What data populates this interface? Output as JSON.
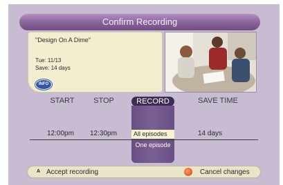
{
  "dialog": {
    "title": "Confirm Recording"
  },
  "program": {
    "title": "\"Design On A Dime\"",
    "date": "Tue:  11/13",
    "save": "Save:  14 days",
    "info_label": "INFO"
  },
  "columns": {
    "start": "START",
    "stop": "STOP",
    "record": "RECORD",
    "save_time": "SAVE TIME"
  },
  "values": {
    "start": "12:00pm",
    "stop": "12:30pm",
    "save_time": "14 days"
  },
  "record_options": {
    "selected": "All episodes",
    "other": "One episode"
  },
  "footer": {
    "accept_key": "A",
    "accept_label": "Accept recording",
    "cancel_label": "Cancel changes"
  },
  "colors": {
    "accent": "#6a4f84",
    "title_bar": "#8e689f",
    "info_button": "#3454a4",
    "cancel_button": "#d23a1a",
    "accept_button": "#f4d21a"
  }
}
